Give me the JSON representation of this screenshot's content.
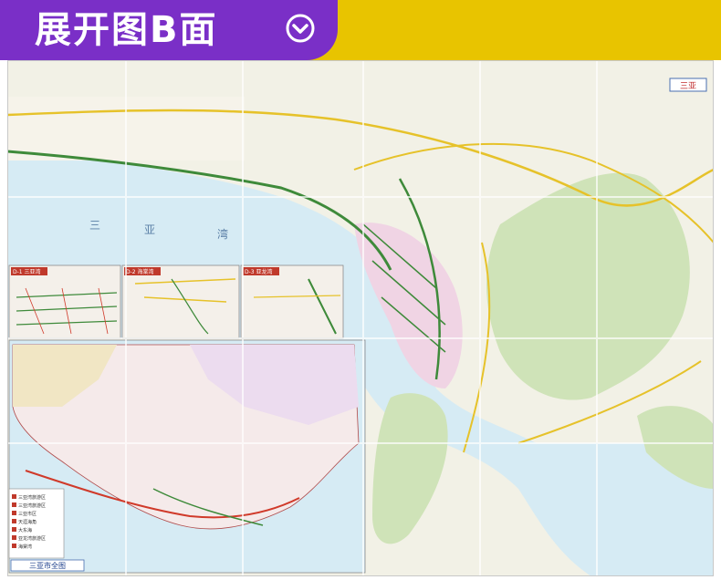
{
  "banner": {
    "title": "展开图B面",
    "icon": "chevron-down-circle-icon",
    "colors": {
      "purple": "#7a2fc7",
      "yellow": "#e8c400"
    }
  },
  "map": {
    "colors": {
      "sea": "#d6ebf4",
      "land": "#f2f1e6",
      "city": "#f0d4e4",
      "green": "#cfe3b8",
      "road_green": "#3e8a3a",
      "road_yellow": "#e6c22a",
      "road_red": "#d03a2a"
    },
    "bay_labels": [
      "三",
      "亚",
      "湾"
    ],
    "corner_label": "三亚",
    "inset_labels": [
      "D-1 三亚湾",
      "D-2 海棠湾",
      "D-3 亚龙湾"
    ],
    "overview_title": "三亚市全图",
    "legend_items": [
      "三亚湾旅游区",
      "三亚湾旅游区",
      "三亚市区",
      "天涯海角",
      "大东海",
      "亚龙湾旅游区",
      "海棠湾"
    ]
  }
}
